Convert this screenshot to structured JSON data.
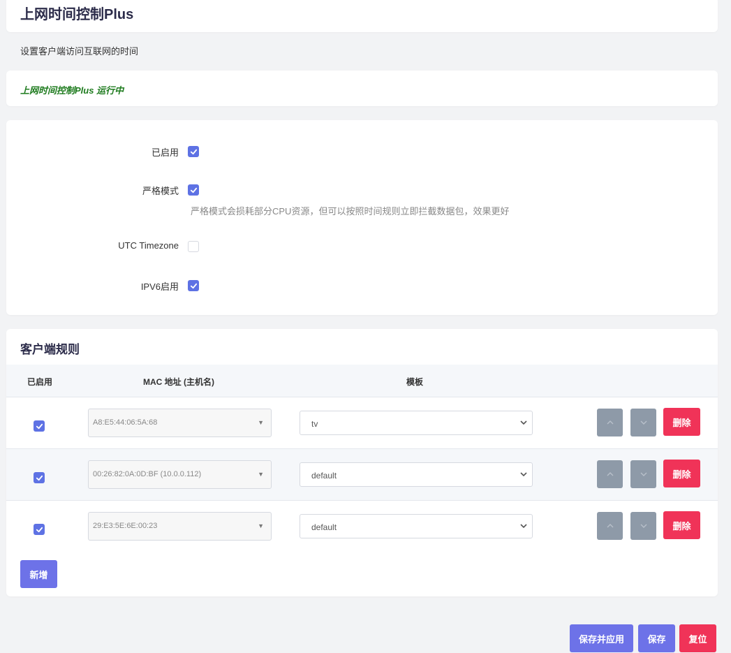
{
  "header": {
    "title": "上网时间控制Plus",
    "description": "设置客户端访问互联网的时间"
  },
  "status": {
    "text": "上网时间控制Plus 运行中",
    "color": "#1e7b1e"
  },
  "settings": {
    "enabled": {
      "label": "已启用",
      "checked": true
    },
    "strict_mode": {
      "label": "严格模式",
      "checked": true,
      "help": "严格模式会损耗部分CPU资源，但可以按照时间规则立即拦截数据包，效果更好"
    },
    "utc_timezone": {
      "label": "UTC Timezone",
      "checked": false
    },
    "ipv6_enabled": {
      "label": "IPV6启用",
      "checked": true
    }
  },
  "rules": {
    "title": "客户端规则",
    "columns": {
      "enabled": "已启用",
      "mac": "MAC 地址 (主机名)",
      "template": "模板"
    },
    "rows": [
      {
        "enabled": true,
        "mac": "A8:E5:44:06:5A:68",
        "template": "tv",
        "delete_label": "删除"
      },
      {
        "enabled": true,
        "mac": "00:26:82:0A:0D:BF (10.0.0.112)",
        "template": "default",
        "delete_label": "删除"
      },
      {
        "enabled": true,
        "mac": "29:E3:5E:6E:00:23",
        "template": "default",
        "delete_label": "删除"
      }
    ],
    "add_label": "新增"
  },
  "footer": {
    "save_apply_label": "保存并应用",
    "save_label": "保存",
    "reset_label": "复位"
  },
  "colors": {
    "accent": "#5e72e4",
    "button_primary": "#6d72e8",
    "danger": "#f03358",
    "move_button": "#8e9aa8"
  },
  "icons": {
    "checkbox": "check-icon",
    "select_caret": "caret-down-icon",
    "move_up": "chevron-up-icon",
    "move_down": "chevron-down-icon"
  }
}
